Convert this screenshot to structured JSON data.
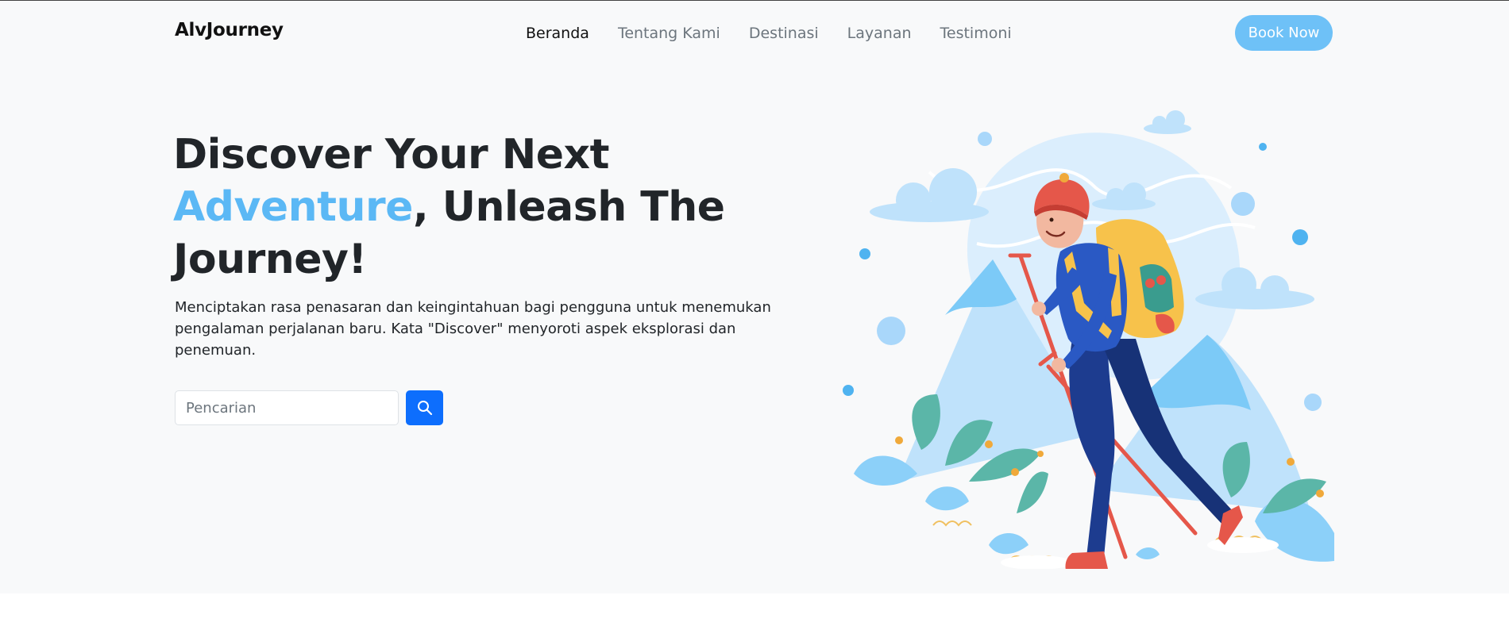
{
  "navbar": {
    "brand": "AlvJourney",
    "links": [
      "Beranda",
      "Tentang Kami",
      "Destinasi",
      "Layanan",
      "Testimoni"
    ],
    "active_link": "Beranda",
    "cta_label": "Book Now"
  },
  "hero": {
    "headline_part1": "Discover Your Next",
    "headline_accent": "Adventure",
    "headline_part2": ", Unleash The Journey!",
    "lead": "Menciptakan rasa penasaran dan keingintahuan bagi pengguna untuk menemukan pengalaman perjalanan baru. Kata \"Discover\" menyoroti aspek eksplorasi dan penemuan.",
    "search": {
      "placeholder": "Pencarian",
      "value": ""
    },
    "illustration": "hiker-with-backpack-illustration"
  },
  "icons": {
    "search": "search-icon"
  },
  "colors": {
    "accent": "#5bb8f5",
    "cta": "#6ec1f7",
    "primary_button": "#0d6efd",
    "background": "#f8f9fa"
  }
}
